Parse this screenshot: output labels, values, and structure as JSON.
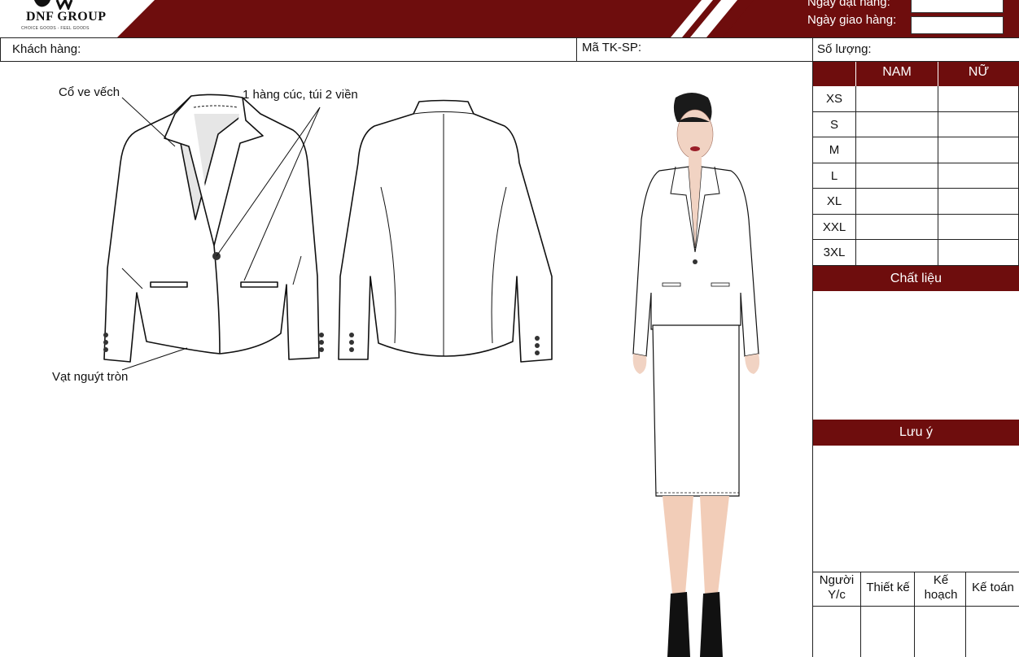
{
  "header": {
    "brand": "DNF GROUP",
    "tagline": "CHOICE GOODS - FEEL GOODS",
    "order_date_label": "Ngày đặt hàng:",
    "delivery_date_label": "Ngày giao hàng:",
    "order_date_value": "",
    "delivery_date_value": ""
  },
  "fields": {
    "customer_label": "Khách hàng:",
    "product_code_label": "Mã TK-SP:",
    "quantity_label": "Số lượng:"
  },
  "size_table": {
    "columns": [
      "NAM",
      "NỮ"
    ],
    "rows": [
      "XS",
      "S",
      "M",
      "L",
      "XL",
      "XXL",
      "3XL"
    ]
  },
  "sections": {
    "material": "Chất liệu",
    "note": "Lưu ý"
  },
  "signatures": [
    "Người Y/c",
    "Thiết kế",
    "Kế hoạch",
    "Kế toán"
  ],
  "annotations": {
    "collar": "Cổ ve vếch",
    "buttons_pockets": "1 hàng cúc, túi 2 viền",
    "hem": "Vạt nguýt tròn"
  },
  "colors": {
    "brand_red": "#6e0d0d"
  }
}
